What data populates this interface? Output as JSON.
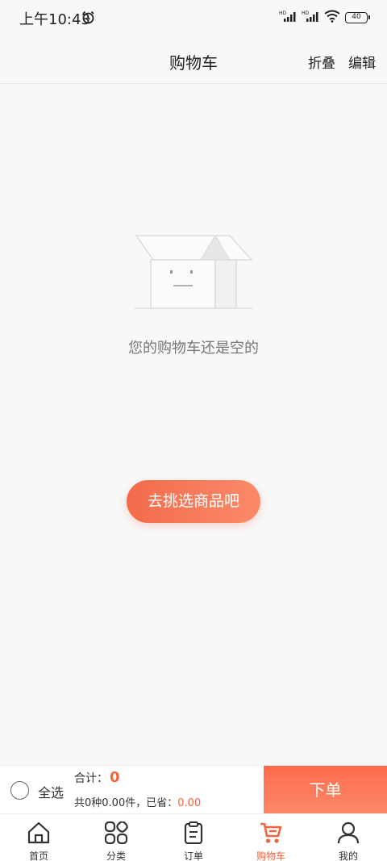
{
  "status_bar": {
    "time": "上午10:43",
    "battery": "40"
  },
  "header": {
    "title": "购物车",
    "actions": [
      {
        "label": "折叠"
      },
      {
        "label": "编辑"
      }
    ]
  },
  "empty_state": {
    "message": "您的购物车还是空的",
    "button_label": "去挑选商品吧"
  },
  "checkout": {
    "select_all_label": "全选",
    "total_label": "合计：",
    "total_value": "0",
    "summary_text": "共0种0.00件，已省：",
    "saved_value": "0.00",
    "order_button_label": "下单"
  },
  "tab_bar": {
    "items": [
      {
        "label": "首页",
        "icon": "home-icon",
        "active": false
      },
      {
        "label": "分类",
        "icon": "category-icon",
        "active": false
      },
      {
        "label": "订单",
        "icon": "order-icon",
        "active": false
      },
      {
        "label": "购物车",
        "icon": "cart-icon",
        "active": true
      },
      {
        "label": "我的",
        "icon": "user-icon",
        "active": false
      }
    ]
  },
  "colors": {
    "accent": "#f2643f",
    "background": "#f8f8f8"
  }
}
